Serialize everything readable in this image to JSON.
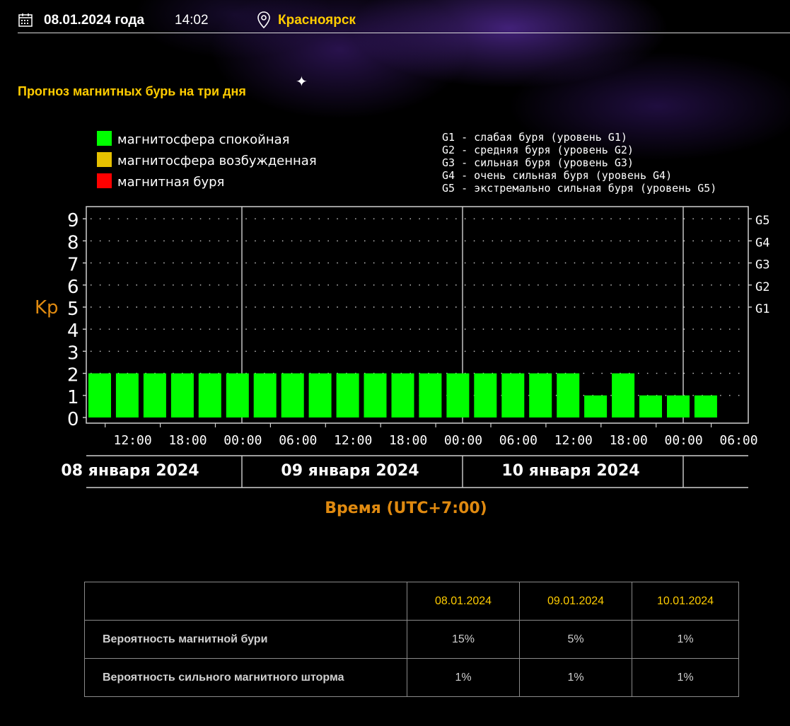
{
  "header": {
    "date": "08.01.2024 года",
    "time": "14:02",
    "city": "Красноярск",
    "calendar_icon": "calendar-icon",
    "location_icon": "map-pin-icon"
  },
  "heading": "Прогноз магнитных бурь на три дня",
  "chart_data": {
    "type": "bar",
    "ylabel": "Kp",
    "xlabel": "Время (UTC+7:00)",
    "ylim": [
      0,
      9
    ],
    "yticks": [
      "0",
      "1",
      "2",
      "3",
      "4",
      "5",
      "6",
      "7",
      "8",
      "9"
    ],
    "right_ticks": [
      {
        "y": 5,
        "label": "G1"
      },
      {
        "y": 6,
        "label": "G2"
      },
      {
        "y": 7,
        "label": "G3"
      },
      {
        "y": 8,
        "label": "G4"
      },
      {
        "y": 9,
        "label": "G5"
      }
    ],
    "legend": [
      {
        "label": "магнитосфера спокойная",
        "color": "#00ff00"
      },
      {
        "label": "магнитосфера возбужденная",
        "color": "#e6c000"
      },
      {
        "label": "магнитная буря",
        "color": "#ff0000"
      }
    ],
    "g_legend": [
      "G1 - слабая буря (уровень G1)",
      "G2 - средняя буря (уровень G2)",
      "G3 - сильная буря (уровень G3)",
      "G4 - очень сильная буря (уровень G4)",
      "G5 - экстремально сильная буря (уровень G5)"
    ],
    "x_tick_labels": [
      "12:00",
      "18:00",
      "00:00",
      "06:00",
      "12:00",
      "18:00",
      "00:00",
      "06:00",
      "12:00",
      "18:00",
      "00:00",
      "06:00"
    ],
    "day_labels": [
      "08 января 2024",
      "09 января 2024",
      "10 января 2024"
    ],
    "bar_color": "#00ff00",
    "values": [
      2,
      2,
      2,
      2,
      2,
      2,
      2,
      2,
      2,
      2,
      2,
      2,
      2,
      2,
      2,
      2,
      2,
      2,
      1,
      2,
      1,
      1,
      1
    ]
  },
  "table": {
    "headers": [
      "",
      "08.01.2024",
      "09.01.2024",
      "10.01.2024"
    ],
    "rows": [
      {
        "label": "Вероятность магнитной бури",
        "values": [
          "15%",
          "5%",
          "1%"
        ]
      },
      {
        "label": "Вероятность сильного магнитного шторма",
        "values": [
          "1%",
          "1%",
          "1%"
        ]
      }
    ]
  }
}
